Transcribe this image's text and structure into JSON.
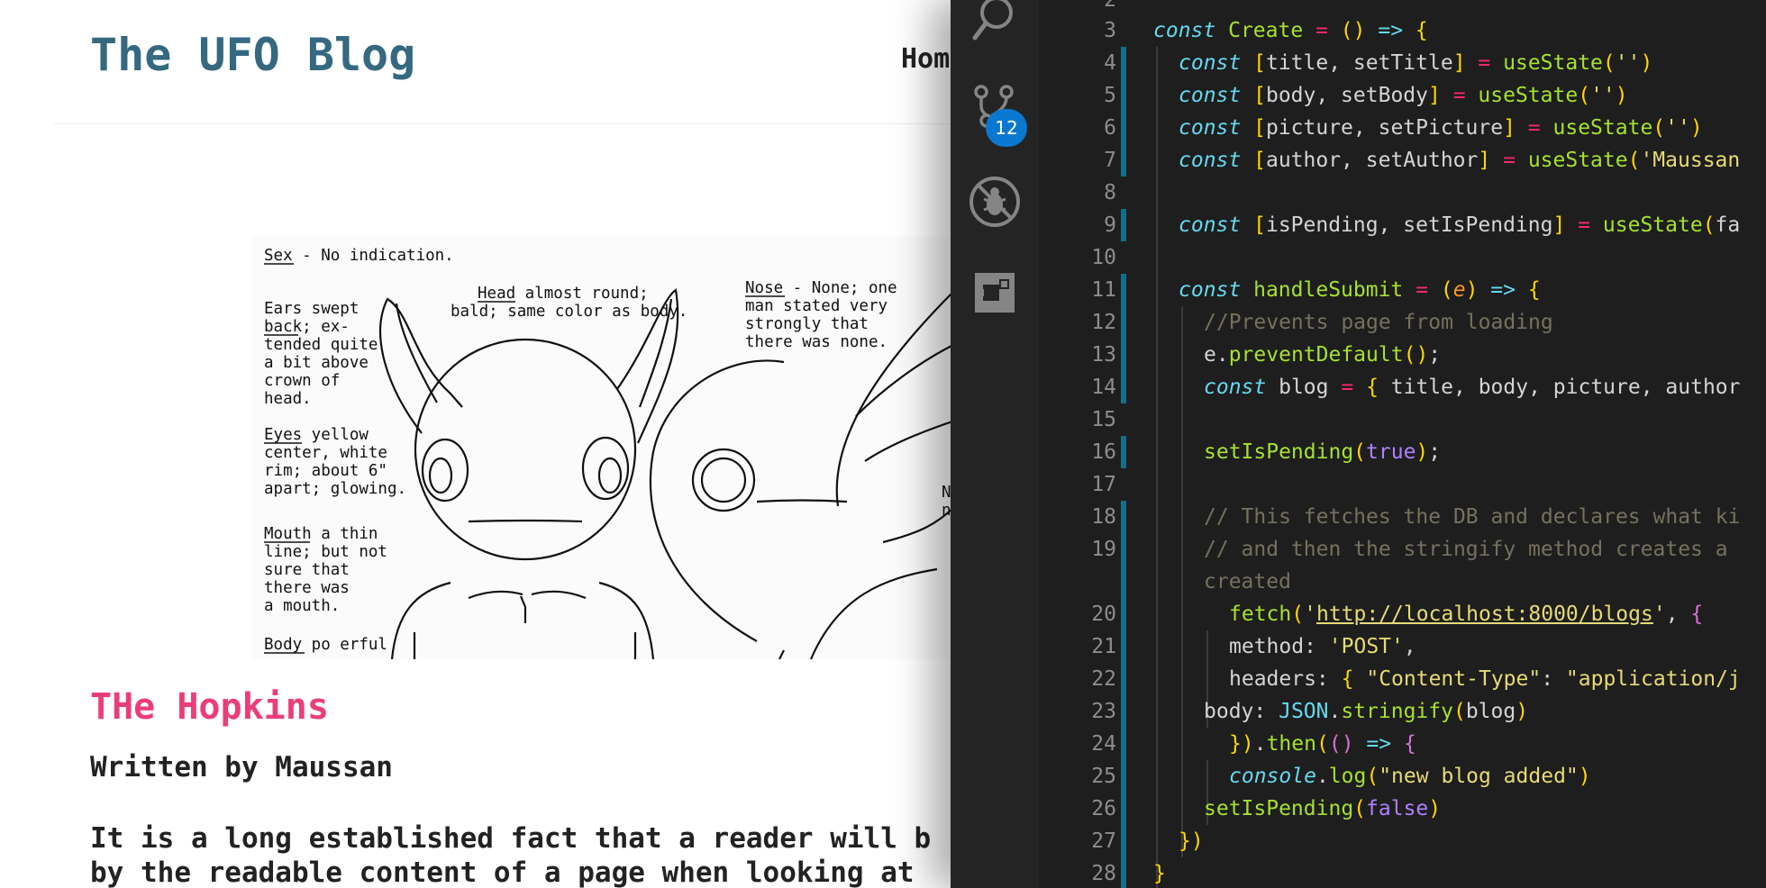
{
  "blog": {
    "site_title": "The UFO Blog",
    "nav_home": "Hom",
    "image": {
      "annotations": [
        "Sex - No indication.",
        "Head almost round;",
        "bald; same color as body.",
        "Nose - None; one",
        "man stated very",
        "strongly that",
        "there was none.",
        "Ears swept",
        "back; ex-",
        "tended quite",
        "a bit above",
        "crown of",
        "head.",
        "Eyes yellow",
        "center, white",
        "rim; about 6\"",
        "apart; glowing.",
        "Mouth a thin",
        "line; but not",
        "sure that",
        "there was",
        "a mouth.",
        "Body po erful",
        "N",
        "n"
      ]
    },
    "post": {
      "title": "THe Hopkins",
      "author": "Written by Maussan",
      "body_line1": "It is a long established fact that a reader will b",
      "body_line2": "by the readable content of a page when looking at"
    }
  },
  "vscode": {
    "activity": {
      "search_icon": "search-icon",
      "source_control_icon": "source-control-icon",
      "source_control_badge": "12",
      "debug_icon": "no-debug-icon",
      "extensions_icon": "extensions-icon"
    },
    "editor": {
      "lines": [
        {
          "n": "2",
          "code": ""
        },
        {
          "n": "3",
          "code": "const Create = () => {"
        },
        {
          "n": "4",
          "code": "const [title, setTitle] = useState('')"
        },
        {
          "n": "5",
          "code": "const [body, setBody] = useState('')"
        },
        {
          "n": "6",
          "code": "const [picture, setPicture] = useState('')"
        },
        {
          "n": "7",
          "code": "const [author, setAuthor] = useState('Maussan"
        },
        {
          "n": "8",
          "code": ""
        },
        {
          "n": "9",
          "code": "const [isPending, setIsPending] = useState(fa"
        },
        {
          "n": "10",
          "code": ""
        },
        {
          "n": "11",
          "code": "const handleSubmit = (e) => {"
        },
        {
          "n": "12",
          "code": "//Prevents page from loading"
        },
        {
          "n": "13",
          "code": "e.preventDefault();"
        },
        {
          "n": "14",
          "code": "const blog = { title, body, picture, author"
        },
        {
          "n": "15",
          "code": ""
        },
        {
          "n": "16",
          "code": "setIsPending(true);"
        },
        {
          "n": "17",
          "code": ""
        },
        {
          "n": "18",
          "code": "// This fetches the DB and declares what ki"
        },
        {
          "n": "19",
          "code": "// and then the stringify method creates a"
        },
        {
          "n": "",
          "code": "created"
        },
        {
          "n": "20",
          "code": "fetch('http://localhost:8000/blogs', {"
        },
        {
          "n": "21",
          "code": "method: 'POST',"
        },
        {
          "n": "22",
          "code": "headers: { \"Content-Type\": \"application/j"
        },
        {
          "n": "23",
          "code": "body: JSON.stringify(blog)"
        },
        {
          "n": "24",
          "code": "}).then(() => {"
        },
        {
          "n": "25",
          "code": "console.log(\"new blog added\")"
        },
        {
          "n": "26",
          "code": "setIsPending(false)"
        },
        {
          "n": "27",
          "code": "})"
        },
        {
          "n": "28",
          "code": "}"
        }
      ]
    }
  }
}
